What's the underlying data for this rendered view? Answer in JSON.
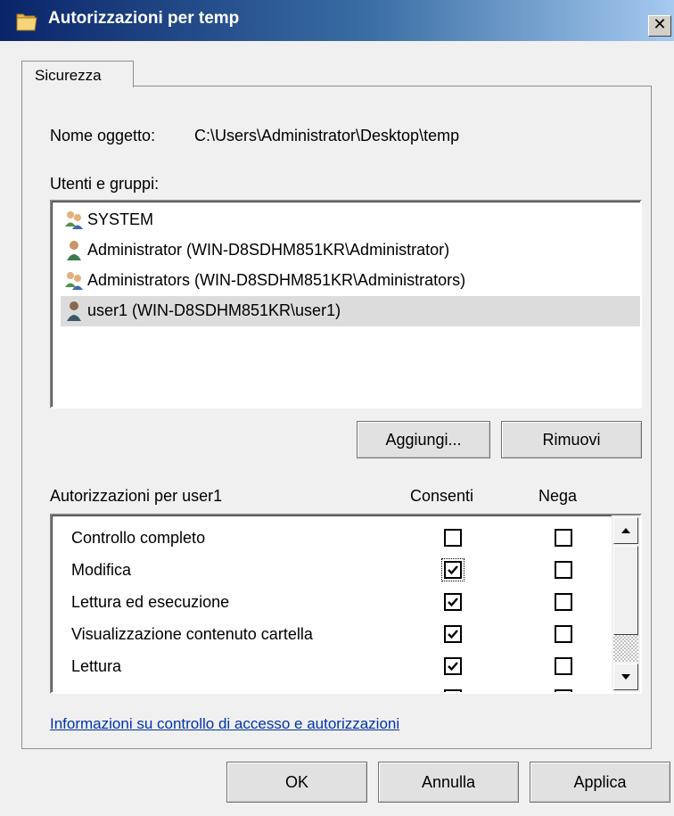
{
  "window": {
    "title": "Autorizzazioni per temp",
    "title_icon": "folder-icon",
    "close_label": "✕"
  },
  "tabs": [
    {
      "label": "Sicurezza"
    }
  ],
  "security": {
    "object_name_label": "Nome oggetto:",
    "object_name_value": "C:\\Users\\Administrator\\Desktop\\temp",
    "users_groups_label": "Utenti e gruppi:",
    "users": [
      {
        "name": "SYSTEM",
        "icon": "group-icon",
        "selected": false
      },
      {
        "name": "Administrator (WIN-D8SDHM851KR\\Administrator)",
        "icon": "user-icon",
        "selected": false
      },
      {
        "name": "Administrators (WIN-D8SDHM851KR\\Administrators)",
        "icon": "group-icon",
        "selected": false
      },
      {
        "name": "user1 (WIN-D8SDHM851KR\\user1)",
        "icon": "user-icon",
        "selected": true
      }
    ],
    "add_button": "Aggiungi...",
    "remove_button": "Rimuovi",
    "permissions_label": "Autorizzazioni per user1",
    "allow_header": "Consenti",
    "deny_header": "Nega",
    "permissions": [
      {
        "name": "Controllo completo",
        "allow": false,
        "deny": false
      },
      {
        "name": "Modifica",
        "allow": true,
        "deny": false,
        "focused": true
      },
      {
        "name": "Lettura ed esecuzione",
        "allow": true,
        "deny": false
      },
      {
        "name": "Visualizzazione contenuto cartella",
        "allow": true,
        "deny": false
      },
      {
        "name": "Lettura",
        "allow": true,
        "deny": false
      }
    ],
    "info_link": "Informazioni su controllo di accesso e autorizzazioni"
  },
  "footer": {
    "ok": "OK",
    "cancel": "Annulla",
    "apply": "Applica"
  },
  "colors": {
    "titlebar_start": "#0a246a",
    "titlebar_end": "#a6caf0",
    "selection": "#dcdcdc",
    "link": "#0033aa"
  }
}
